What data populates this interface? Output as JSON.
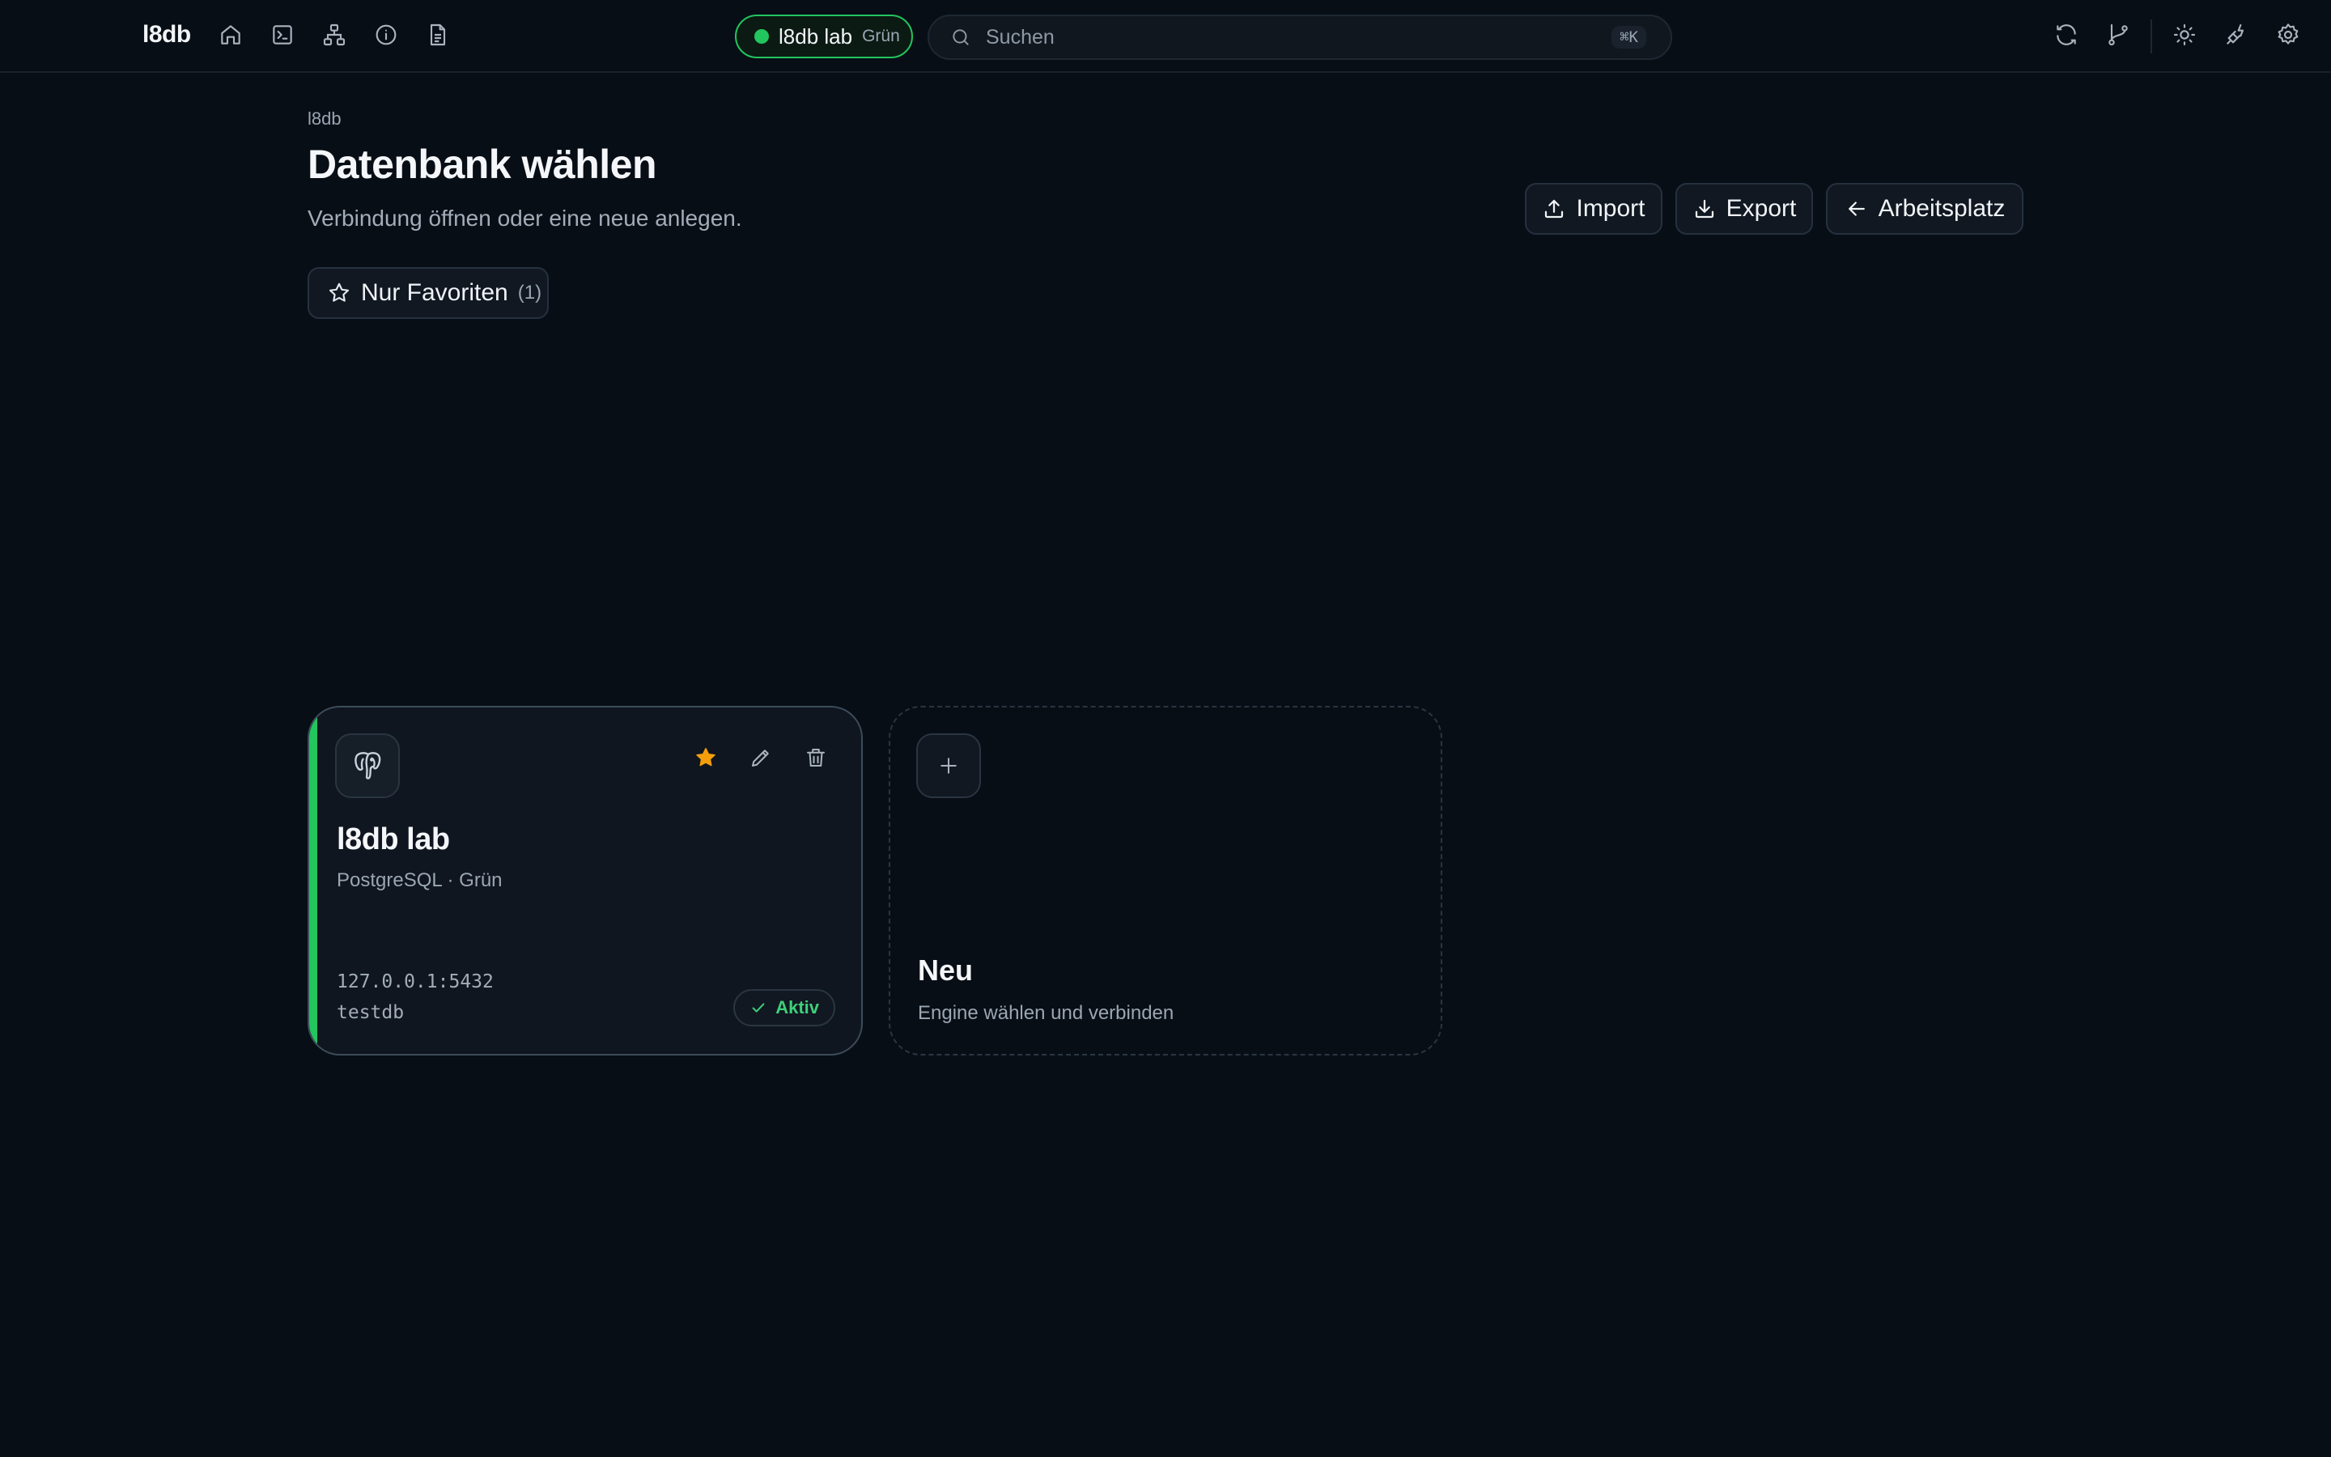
{
  "app": {
    "brand": "l8db"
  },
  "nav_icons": [
    "home-icon",
    "terminal-icon",
    "schema-icon",
    "info-icon",
    "document-icon"
  ],
  "connection": {
    "name": "l8db lab",
    "environment": "Grün",
    "status_color": "#22c55e"
  },
  "search": {
    "placeholder": "Suchen",
    "shortcut": "⌘K"
  },
  "right_icons": [
    "refresh-icon",
    "git-branch-icon",
    "theme-sun-icon",
    "plug-icon",
    "settings-gear-icon"
  ],
  "header": {
    "breadcrumb": "l8db",
    "title": "Datenbank wählen",
    "subtitle": "Verbindung öffnen oder eine neue anlegen."
  },
  "actions": {
    "import": "Import",
    "export": "Export",
    "workspace": "Arbeitsplatz"
  },
  "filter": {
    "label": "Nur Favoriten",
    "count": "(1)"
  },
  "connections": [
    {
      "name": "l8db lab",
      "engine_env": "PostgreSQL · Grün",
      "host": "127.0.0.1:5432",
      "database": "testdb",
      "status": "Aktiv",
      "favorite": true,
      "accent_color": "#22c55e"
    }
  ],
  "new_card": {
    "title": "Neu",
    "subtitle": "Engine wählen und verbinden"
  },
  "colors": {
    "background": "#080e16",
    "accent": "#22c55e",
    "favorite": "#f59e0b"
  }
}
